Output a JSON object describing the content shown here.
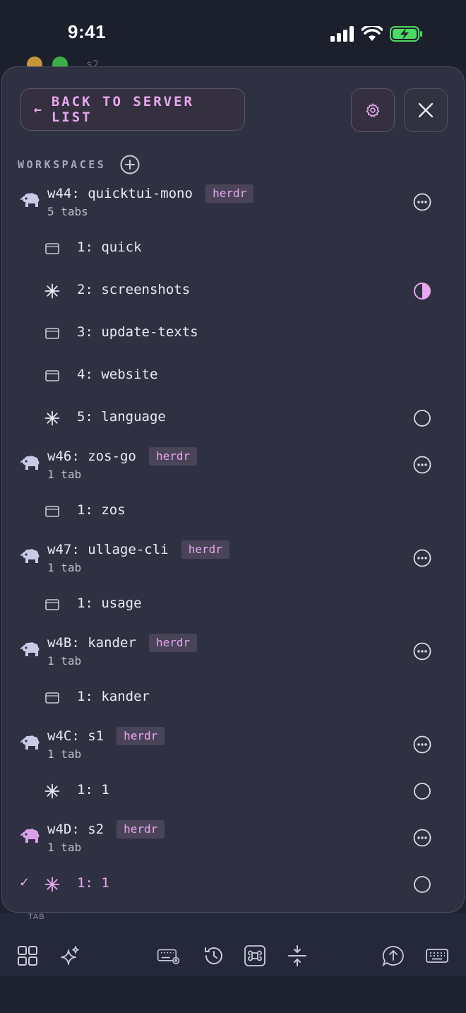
{
  "status_bar": {
    "time": "9:41",
    "icons": [
      "cellular-signal-icon",
      "wifi-icon",
      "battery-charging-icon"
    ],
    "battery_color": "#4cd964"
  },
  "background": {
    "session_label": "s2"
  },
  "header": {
    "back_label": "BACK TO SERVER LIST",
    "settings_icon": "gear-icon",
    "close_icon": "close-icon"
  },
  "workspaces_section": {
    "label": "WORKSPACES",
    "add_icon": "plus-circle-icon"
  },
  "workspaces": [
    {
      "title": "w44: quicktui-mono",
      "badge": "herdr",
      "subtitle": "5 tabs",
      "tabs": [
        {
          "label": "1: quick",
          "icon": "window-icon",
          "status": ""
        },
        {
          "label": "2: screenshots",
          "icon": "sparkle-icon",
          "status": "half-circle"
        },
        {
          "label": "3: update-texts",
          "icon": "window-icon",
          "status": ""
        },
        {
          "label": "4: website",
          "icon": "window-icon",
          "status": ""
        },
        {
          "label": "5: language",
          "icon": "sparkle-icon",
          "status": "empty-circle"
        }
      ]
    },
    {
      "title": "w46: zos-go",
      "badge": "herdr",
      "subtitle": "1 tab",
      "tabs": [
        {
          "label": "1: zos",
          "icon": "window-icon",
          "status": ""
        }
      ]
    },
    {
      "title": "w47: ullage-cli",
      "badge": "herdr",
      "subtitle": "1 tab",
      "tabs": [
        {
          "label": "1: usage",
          "icon": "window-icon",
          "status": ""
        }
      ]
    },
    {
      "title": "w4B: kander",
      "badge": "herdr",
      "subtitle": "1 tab",
      "tabs": [
        {
          "label": "1: kander",
          "icon": "window-icon",
          "status": ""
        }
      ]
    },
    {
      "title": "w4C: s1",
      "badge": "herdr",
      "subtitle": "1 tab",
      "tabs": [
        {
          "label": "1: 1",
          "icon": "sparkle-icon",
          "status": "empty-circle"
        }
      ]
    },
    {
      "title": "w4D: s2",
      "badge": "herdr",
      "subtitle": "1 tab",
      "active": true,
      "tabs": [
        {
          "label": "1: 1",
          "icon": "sparkle-icon",
          "status": "empty-circle",
          "selected": true
        }
      ]
    }
  ],
  "toolbar": {
    "key_hint": "TAB",
    "buttons": [
      "grid-icon",
      "sparkles-icon",
      "keyboard-settings-icon",
      "history-icon",
      "command-icon",
      "split-icon",
      "upload-message-icon",
      "keyboard-icon"
    ]
  },
  "colors": {
    "accent": "#e8a7ee",
    "panel": "#2f3143",
    "badge_bg": "#4a4458"
  }
}
